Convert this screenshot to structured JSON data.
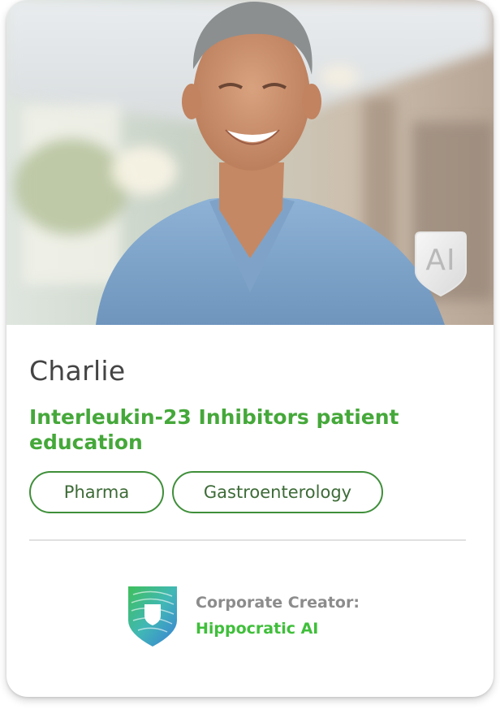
{
  "card": {
    "name": "Charlie",
    "subtitle": "Interleukin-23 Inhibitors patient education",
    "badge_text": "AI",
    "tags": [
      "Pharma",
      "Gastroenterology"
    ],
    "creator_label": "Corporate Creator:",
    "creator_name": "Hippocratic AI"
  },
  "icons": {
    "badge": "ai-shield-icon",
    "creator_logo": "hippocratic-ai-shield-logo"
  },
  "colors": {
    "subtitle_green": "#45a83a",
    "tag_border": "#3f8f3a",
    "creator_green": "#3fbf3a",
    "name_text": "#444444"
  }
}
